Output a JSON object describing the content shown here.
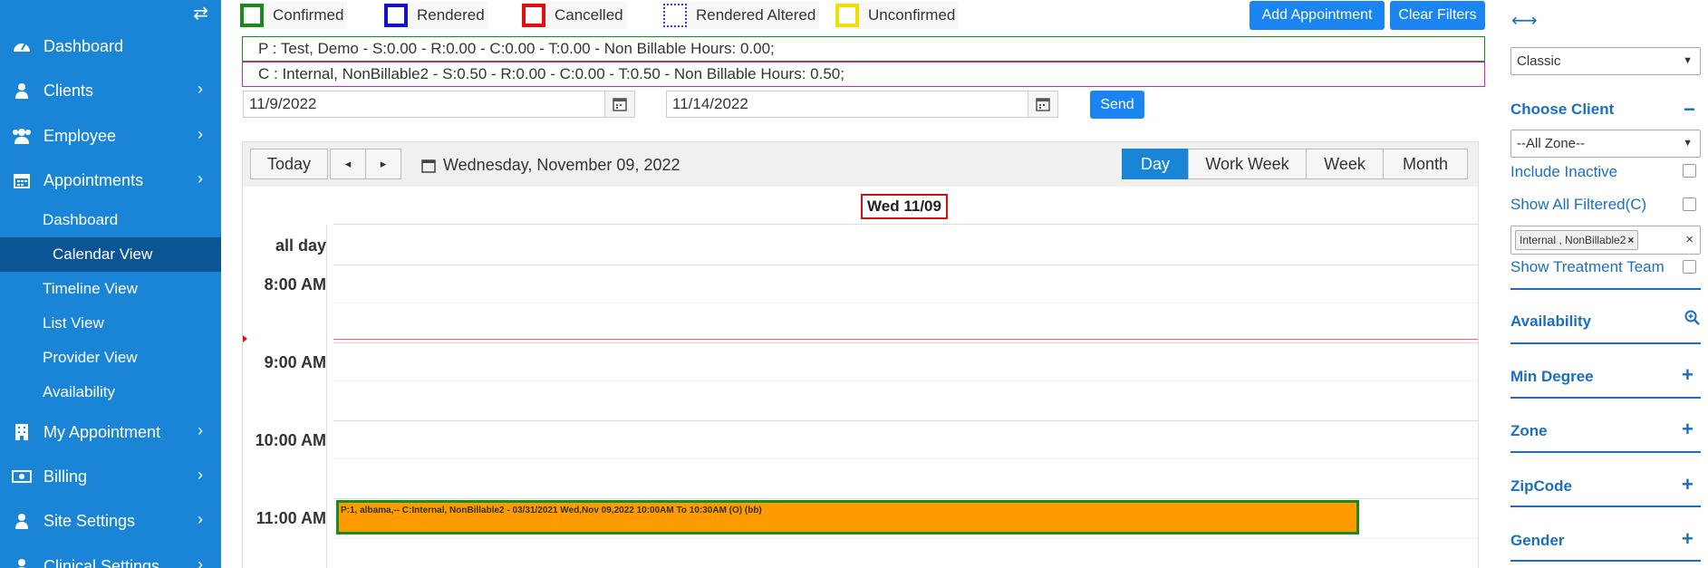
{
  "sidebar": {
    "items": [
      {
        "label": "Dashboard",
        "icon": "dashboard-icon"
      },
      {
        "label": "Clients",
        "icon": "user-icon"
      },
      {
        "label": "Employee",
        "icon": "users-icon"
      },
      {
        "label": "Appointments",
        "icon": "calendar-icon"
      },
      {
        "label": "My Appointment",
        "icon": "building-icon"
      },
      {
        "label": "Billing",
        "icon": "money-icon"
      },
      {
        "label": "Site Settings",
        "icon": "user-icon"
      },
      {
        "label": "Clinical Settings",
        "icon": "user-icon"
      }
    ],
    "sub_items": [
      "Dashboard",
      "Calendar View",
      "Timeline View",
      "List View",
      "Provider View",
      "Availability"
    ]
  },
  "legend": [
    {
      "label": "Confirmed",
      "color": "#1a8a1a"
    },
    {
      "label": "Rendered",
      "color": "#1010d0"
    },
    {
      "label": "Cancelled",
      "color": "#e01010"
    },
    {
      "label": "Rendered Altered",
      "color": "#3b3bd6"
    },
    {
      "label": "Unconfirmed",
      "color": "#f0e000"
    }
  ],
  "buttons": {
    "add": "Add Appointment",
    "clear": "Clear Filters",
    "send": "Send"
  },
  "summary": {
    "provider": "P : Test, Demo - S:0.00 - R:0.00 - C:0.00 - T:0.00 - Non Billable Hours: 0.00;",
    "client": "C : Internal, NonBillable2 - S:0.50 - R:0.00 - C:0.00 - T:0.50 - Non Billable Hours: 0.50;"
  },
  "dates": {
    "from": "11/9/2022",
    "to": "11/14/2022"
  },
  "toolbar": {
    "today": "Today",
    "prev": "◂",
    "next": "▸",
    "date_label": "Wednesday, November 09, 2022",
    "views": [
      "Day",
      "Work Week",
      "Week",
      "Month"
    ]
  },
  "calendar": {
    "day_header": "Wed 11/09",
    "all_day": "all day",
    "times": [
      "8:00 AM",
      "9:00 AM",
      "10:00 AM",
      "11:00 AM"
    ],
    "event": "P:1, albama,-- C:Internal, NonBillable2 - 03/31/2021 Wed,Nov 09,2022 10:00AM To 10:30AM (O) (bb)"
  },
  "right_panel": {
    "expand": "⟷",
    "style_select": "Classic",
    "choose_client": "Choose Client",
    "zone_select": "--All Zone--",
    "include_inactive": "Include Inactive",
    "show_all_filtered": "Show All Filtered(C)",
    "tag": "Internal , NonBillable2",
    "show_treatment_team": "Show Treatment Team",
    "sections": [
      "Availability",
      "Min Degree",
      "Zone",
      "ZipCode",
      "Gender"
    ]
  }
}
